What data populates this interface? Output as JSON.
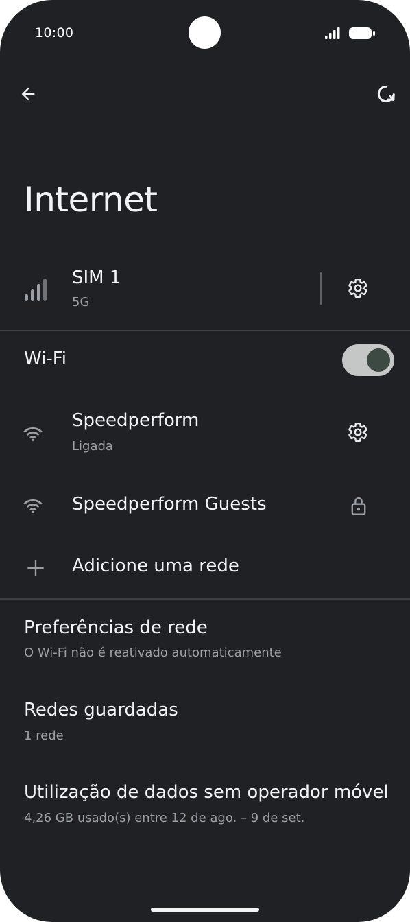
{
  "status_bar": {
    "time": "10:00"
  },
  "header": {
    "title": "Internet"
  },
  "sim": {
    "name": "SIM 1",
    "network": "5G"
  },
  "wifi": {
    "label": "Wi-Fi",
    "enabled": true,
    "networks": [
      {
        "name": "Speedperform",
        "status": "Ligada",
        "action_icon": "gear-icon"
      },
      {
        "name": "Speedperform Guests",
        "status": "",
        "action_icon": "lock-icon"
      }
    ],
    "add_network": "Adicione uma rede"
  },
  "preferences": [
    {
      "title": "Preferências de rede",
      "subtitle": "O Wi-Fi não é reativado automaticamente"
    },
    {
      "title": "Redes guardadas",
      "subtitle": "1 rede"
    },
    {
      "title": "Utilização de dados sem operador móvel",
      "subtitle": "4,26 GB usado(s) entre 12 de ago. – 9 de set."
    }
  ]
}
